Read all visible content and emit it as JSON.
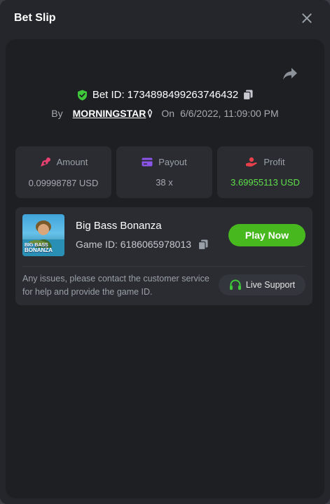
{
  "modal": {
    "title": "Bet Slip"
  },
  "bet": {
    "id_label": "Bet ID:",
    "id_value": "1734898499263746432",
    "by_label": "By",
    "username": "MORNINGSTAR",
    "on_label": "On",
    "datetime": "6/6/2022, 11:09:00 PM"
  },
  "stats": [
    {
      "label": "Amount",
      "value": "0.09998787 USD",
      "icon": "amount-icon"
    },
    {
      "label": "Payout",
      "value": "38 x",
      "icon": "payout-card-icon"
    },
    {
      "label": "Profit",
      "value": "3.69955113 USD",
      "icon": "profit-hand-icon"
    }
  ],
  "game": {
    "name": "Big Bass Bonanza",
    "id_label": "Game ID:",
    "id_value": "6186065978013",
    "thumb_text_1": "BIG BASS",
    "thumb_text_2": "BONANZA",
    "play_label": "Play Now",
    "help_text": "Any issues, please contact the customer service for help and provide the game ID.",
    "support_label": "Live Support"
  },
  "colors": {
    "accent_green": "#48b81f",
    "profit_green": "#5fe04a",
    "shield_green": "#3ec83a",
    "amount_pink": "#e8406f",
    "payout_purple": "#8a55e8",
    "profit_red": "#e8404a"
  }
}
